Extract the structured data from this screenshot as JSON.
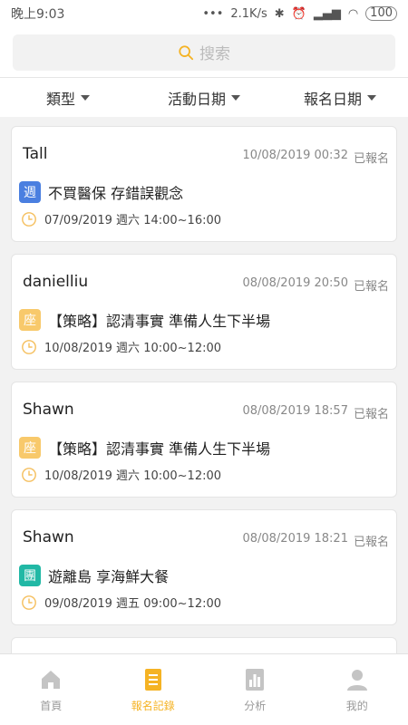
{
  "status_bar": {
    "time": "晚上9:03",
    "network_speed": "2.1K/s",
    "battery": "100"
  },
  "search": {
    "placeholder": "搜索"
  },
  "filters": [
    {
      "label": "類型"
    },
    {
      "label": "活動日期"
    },
    {
      "label": "報名日期"
    }
  ],
  "records": [
    {
      "user": "Tall",
      "registered_at": "10/08/2019 00:32",
      "status": "已報名",
      "tag": "週",
      "tag_color": "#4a7fe0",
      "title": "不買醫保 存錯誤觀念",
      "time": "07/09/2019 週六 14:00~16:00"
    },
    {
      "user": "danielliu",
      "registered_at": "08/08/2019 20:50",
      "status": "已報名",
      "tag": "座",
      "tag_color": "#f8c96b",
      "title": "【策略】認清事實 準備人生下半場",
      "time": "10/08/2019 週六 10:00~12:00"
    },
    {
      "user": "Shawn",
      "registered_at": "08/08/2019 18:57",
      "status": "已報名",
      "tag": "座",
      "tag_color": "#f8c96b",
      "title": "【策略】認清事實 準備人生下半場",
      "time": "10/08/2019 週六 10:00~12:00"
    },
    {
      "user": "Shawn",
      "registered_at": "08/08/2019 18:21",
      "status": "已報名",
      "tag": "團",
      "tag_color": "#21b8a5",
      "title": "遊離島 享海鮮大餐",
      "time": "09/08/2019 週五 09:00~12:00"
    }
  ],
  "tabs": [
    {
      "label": "首頁",
      "icon": "home-icon"
    },
    {
      "label": "報名記錄",
      "icon": "document-icon",
      "active": true
    },
    {
      "label": "分析",
      "icon": "bar-chart-icon"
    },
    {
      "label": "我的",
      "icon": "person-icon"
    }
  ],
  "colors": {
    "accent": "#f5b324",
    "clock": "#f5c060"
  }
}
